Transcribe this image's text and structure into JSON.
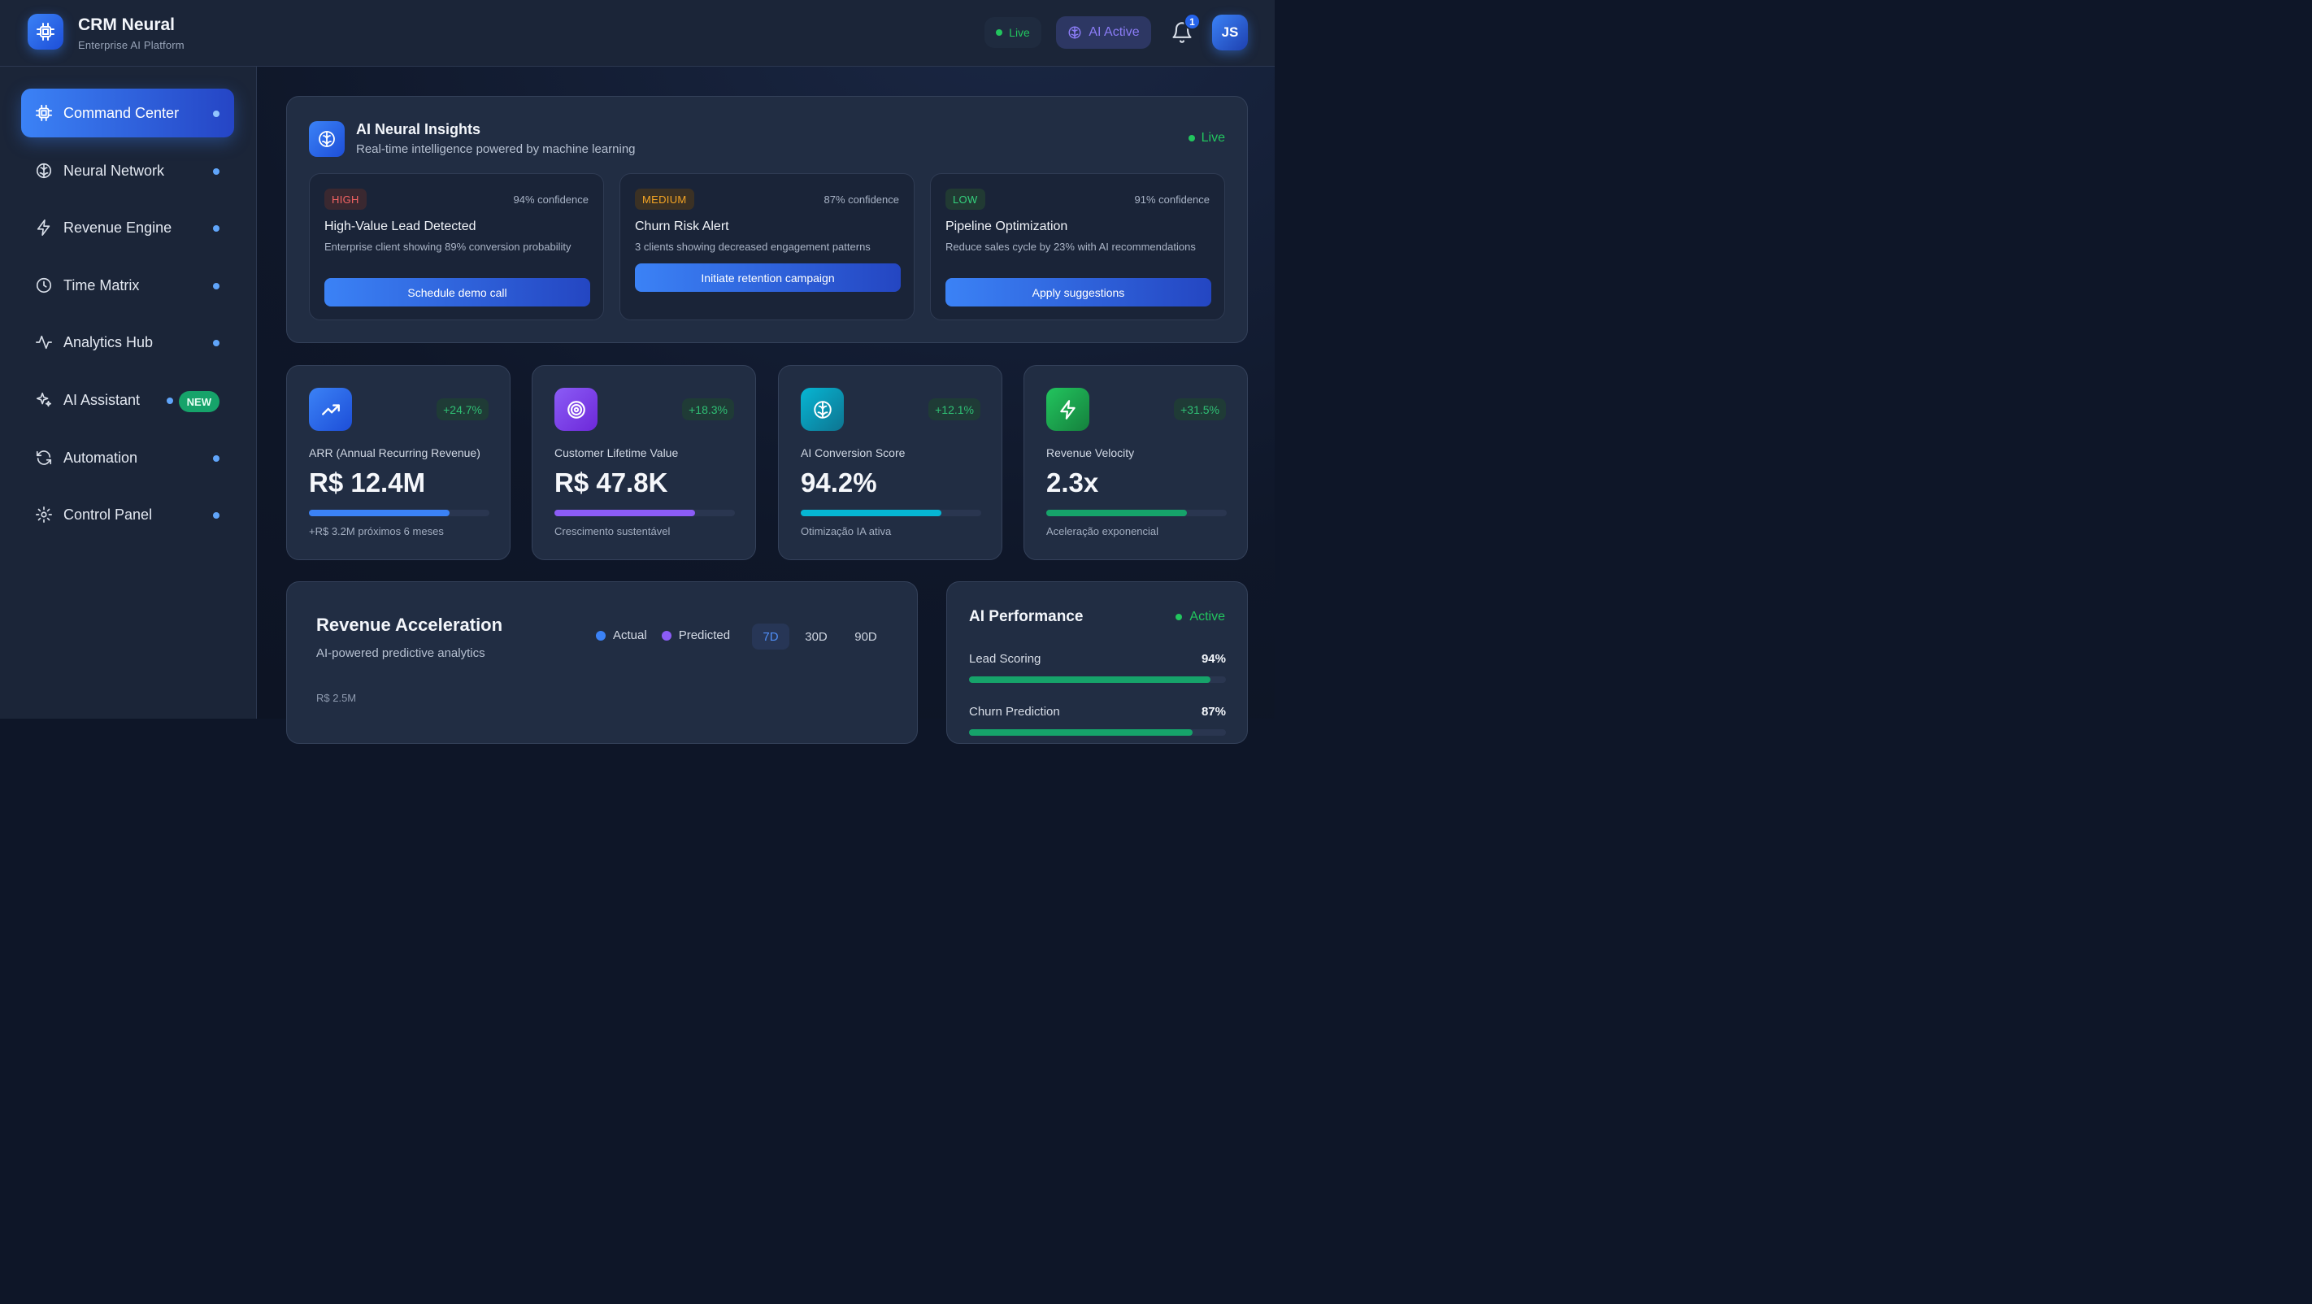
{
  "header": {
    "brand_title": "CRM Neural",
    "brand_subtitle": "Enterprise AI Platform",
    "live_label": "Live",
    "ai_label": "AI Active",
    "notification_count": "1",
    "avatar_initials": "JS"
  },
  "sidebar": {
    "items": [
      {
        "label": "Command Center",
        "icon": "cpu-icon",
        "active": true
      },
      {
        "label": "Neural Network",
        "icon": "brain-icon"
      },
      {
        "label": "Revenue Engine",
        "icon": "lightning-icon"
      },
      {
        "label": "Time Matrix",
        "icon": "clock-icon"
      },
      {
        "label": "Analytics Hub",
        "icon": "activity-icon"
      },
      {
        "label": "AI Assistant",
        "icon": "sparkles-icon",
        "badge": "NEW"
      },
      {
        "label": "Automation",
        "icon": "refresh-icon"
      },
      {
        "label": "Control Panel",
        "icon": "gear-icon"
      }
    ]
  },
  "insights": {
    "title": "AI Neural Insights",
    "subtitle": "Real-time intelligence powered by machine learning",
    "status": "Live",
    "cards": [
      {
        "priority": "HIGH",
        "confidence": "94% confidence",
        "title": "High-Value Lead Detected",
        "description": "Enterprise client showing 89% conversion probability",
        "action": "Schedule demo call"
      },
      {
        "priority": "MEDIUM",
        "confidence": "87% confidence",
        "title": "Churn Risk Alert",
        "description": "3 clients showing decreased engagement patterns",
        "action": "Initiate retention campaign"
      },
      {
        "priority": "LOW",
        "confidence": "91% confidence",
        "title": "Pipeline Optimization",
        "description": "Reduce sales cycle by 23% with AI recommendations",
        "action": "Apply suggestions"
      }
    ]
  },
  "kpis": [
    {
      "label": "ARR (Annual Recurring Revenue)",
      "value": "R$ 12.4M",
      "delta": "+24.7%",
      "footnote": "+R$ 3.2M próximos 6 meses",
      "progress": 0.78,
      "color": "#3b82f6",
      "icon": "trending-up-icon"
    },
    {
      "label": "Customer Lifetime Value",
      "value": "R$ 47.8K",
      "delta": "+18.3%",
      "footnote": "Crescimento sustentável",
      "progress": 0.78,
      "color": "#8b5cf6",
      "icon": "target-icon"
    },
    {
      "label": "AI Conversion Score",
      "value": "94.2%",
      "delta": "+12.1%",
      "footnote": "Otimização IA ativa",
      "progress": 0.78,
      "color": "#06b6d4",
      "icon": "brain-icon"
    },
    {
      "label": "Revenue Velocity",
      "value": "2.3x",
      "delta": "+31.5%",
      "footnote": "Aceleração exponencial",
      "progress": 0.78,
      "color": "#16a36a",
      "icon": "lightning-icon"
    }
  ],
  "revenue": {
    "title": "Revenue Acceleration",
    "subtitle": "AI-powered predictive analytics",
    "legend_actual": "Actual",
    "legend_predicted": "Predicted",
    "ranges": [
      "7D",
      "30D",
      "90D"
    ],
    "selected_range": "7D",
    "axis_top": "R$ 2.5M",
    "colors": {
      "actual": "#3b82f6",
      "predicted": "#8b5cf6"
    }
  },
  "performance": {
    "title": "AI Performance",
    "status": "Active",
    "rows": [
      {
        "label": "Lead Scoring",
        "value": "94%",
        "progress": 0.94
      },
      {
        "label": "Churn Prediction",
        "value": "87%",
        "progress": 0.87
      }
    ]
  }
}
